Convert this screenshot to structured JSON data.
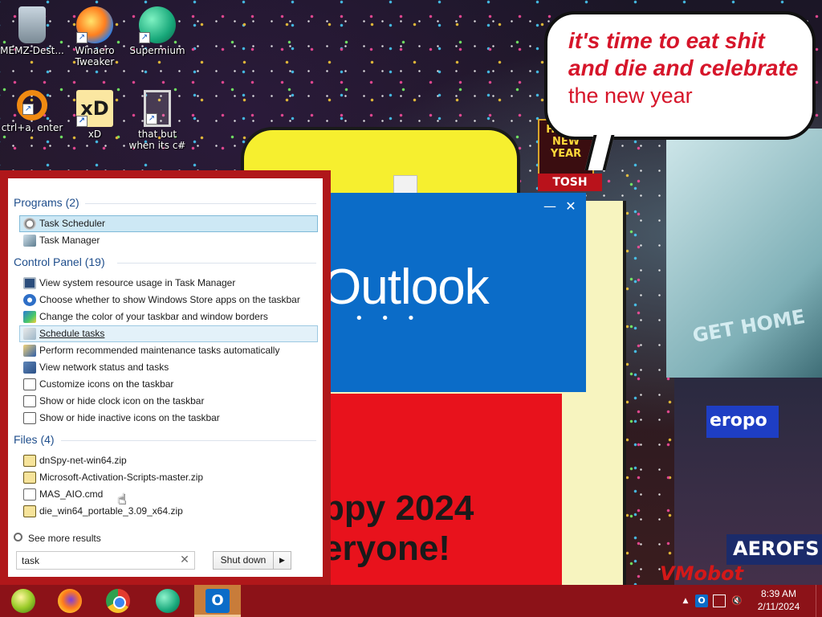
{
  "wallpaper": {
    "bubble_line1": "it's time to eat shit",
    "bubble_line2": "and die and celebrate",
    "bubble_line3": "the new year",
    "sign_happy": "HAPPY NEW YEAR",
    "sign_tosh": "TOSH",
    "ad_get_home": "GET HOME",
    "ad_airport": "eropo",
    "ad_aerofs": "AEROFS",
    "happy_line1": "ppy 2024",
    "happy_line2": "eryone!",
    "signature": "VMobot"
  },
  "desktop_icons": [
    {
      "label": "MEMZ-Dest...",
      "icon": "recycle-bin-icon"
    },
    {
      "label": "Winaero Tweaker",
      "icon": "winaero-icon"
    },
    {
      "label": "Supermium",
      "icon": "supermium-icon"
    },
    {
      "label": "ctrl+a, enter",
      "icon": "ring-icon"
    },
    {
      "label": "xD",
      "icon": "xd-icon"
    },
    {
      "label": "that but when its c#",
      "icon": "copy-icon"
    }
  ],
  "outlook_splash": {
    "title": "Outlook",
    "dots": "• • •",
    "minimize": "—",
    "close": "✕",
    "bg_color": "#0b6cc8"
  },
  "start_menu": {
    "programs_header": "Programs",
    "programs_count": "(2)",
    "programs": [
      {
        "label": "Task Scheduler",
        "icon": "clock-icon"
      },
      {
        "label": "Task Manager",
        "icon": "task-manager-icon"
      }
    ],
    "control_panel_header": "Control Panel",
    "control_panel_count": "(19)",
    "control_panel": [
      {
        "label": "View system resource usage in Task Manager",
        "icon": "monitor-icon"
      },
      {
        "label": "Choose whether to show Windows Store apps on the taskbar",
        "icon": "gear-icon"
      },
      {
        "label": "Change the color of your taskbar and window borders",
        "icon": "color-icon"
      },
      {
        "label": "Schedule tasks",
        "icon": "schedule-icon"
      },
      {
        "label": "Perform recommended maintenance tasks automatically",
        "icon": "maintenance-icon"
      },
      {
        "label": "View network status and tasks",
        "icon": "network-icon"
      },
      {
        "label": "Customize icons on the taskbar",
        "icon": "taskbar-icon"
      },
      {
        "label": "Show or hide clock icon on the taskbar",
        "icon": "taskbar-icon"
      },
      {
        "label": "Show or hide inactive icons on the taskbar",
        "icon": "taskbar-icon"
      }
    ],
    "files_header": "Files",
    "files_count": "(4)",
    "files": [
      {
        "label": "dnSpy-net-win64.zip",
        "icon": "zip-icon"
      },
      {
        "label": "Microsoft-Activation-Scripts-master.zip",
        "icon": "zip-icon"
      },
      {
        "label": "MAS_AIO.cmd",
        "icon": "cmd-icon"
      },
      {
        "label": "die_win64_portable_3.09_x64.zip",
        "icon": "zip-icon"
      }
    ],
    "see_more": "See more results",
    "search_value": "task",
    "search_clear": "✕",
    "shutdown_label": "Shut down",
    "shutdown_arrow": "▶",
    "accent_color": "#b0171a"
  },
  "taskbar": {
    "apps": [
      {
        "name": "start",
        "icon": "start-orb-icon"
      },
      {
        "name": "firefox",
        "icon": "firefox-icon"
      },
      {
        "name": "chrome",
        "icon": "chrome-icon"
      },
      {
        "name": "supermium",
        "icon": "supermium-icon"
      },
      {
        "name": "outlook",
        "icon": "outlook-icon",
        "glyph": "O"
      }
    ],
    "tray": {
      "chevron": "▲",
      "time": "8:39 AM",
      "date": "2/11/2024"
    },
    "color": "#8c1218"
  }
}
